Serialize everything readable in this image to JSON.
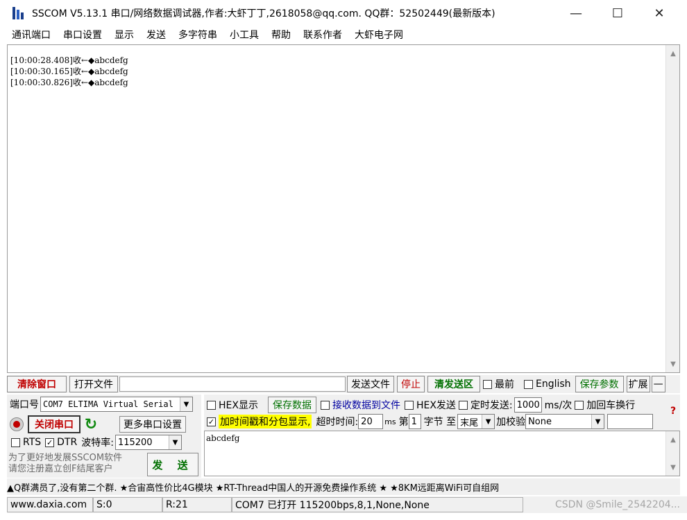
{
  "window": {
    "title": "SSCOM V5.13.1 串口/网络数据调试器,作者:大虾丁丁,2618058@qq.com. QQ群：52502449(最新版本)",
    "controls": {
      "minimize": "—",
      "maximize": "☐",
      "close": "✕"
    }
  },
  "menu": [
    "通讯端口",
    "串口设置",
    "显示",
    "发送",
    "多字符串",
    "小工具",
    "帮助",
    "联系作者",
    "大虾电子网"
  ],
  "receive": {
    "lines": [
      "[10:00:28.408]收←◆abcdefg",
      "[10:00:30.165]收←◆abcdefg",
      "[10:00:30.826]收←◆abcdefg"
    ]
  },
  "toolbar": {
    "clear_window": "清除窗口",
    "open_file": "打开文件",
    "file_path": "",
    "send_file": "发送文件",
    "stop": "停止",
    "clear_send": "清发送区",
    "latest_checked": false,
    "latest_label": "最前",
    "english_checked": false,
    "english_label": "English",
    "save_params": "保存参数",
    "expand": "扩展",
    "collapse": "—"
  },
  "port": {
    "port_label": "端口号",
    "port_value": "COM7 ELTIMA Virtual Serial",
    "close_port": "关闭串口",
    "more_settings": "更多串口设置",
    "rts_label": "RTS",
    "rts_checked": false,
    "dtr_label": "DTR",
    "dtr_checked": true,
    "baud_label": "波特率:",
    "baud_value": "115200"
  },
  "promo": {
    "line1": "为了更好地发展SSCOM软件",
    "line2": "请您注册嘉立创F结尾客户"
  },
  "send_button": "发 送",
  "options": {
    "hex_display_label": "HEX显示",
    "hex_display_checked": false,
    "save_data": "保存数据",
    "recv_to_file_label": "接收数据到文件",
    "recv_to_file_checked": false,
    "hex_send_label": "HEX发送",
    "hex_send_checked": false,
    "timed_send_label": "定时发送:",
    "timed_send_checked": false,
    "interval_value": "1000",
    "interval_unit": "ms/次",
    "crlf_label": "加回车换行",
    "crlf_checked": false,
    "timestamp_label": "加时间戳和分包显示,",
    "timestamp_checked": true,
    "timeout_label": "超时时间:",
    "timeout_value": "20",
    "timeout_unit": "ms",
    "byte_prefix": "第",
    "byte_value": "1",
    "byte_suffix": "字节 至",
    "end_value": "末尾",
    "checksum_label": "加校验",
    "checksum_value": "None",
    "help": "?"
  },
  "send_area": {
    "text": "abcdefg"
  },
  "marquee": "▲Q群满员了,没有第二个群. ★合宙高性价比4G模块 ★RT-Thread中国人的开源免费操作系统 ★ ★8KM远距离WiFi可自组网",
  "status": {
    "website": "www.daxia.com",
    "sent": "S:0",
    "received": "R:21",
    "port_state": "COM7 已打开  115200bps,8,1,None,None"
  },
  "watermark": "CSDN @Smile_2542204...",
  "colors": {
    "accent_red": "#c00000",
    "accent_green": "#007000",
    "highlight": "#ffff00"
  }
}
